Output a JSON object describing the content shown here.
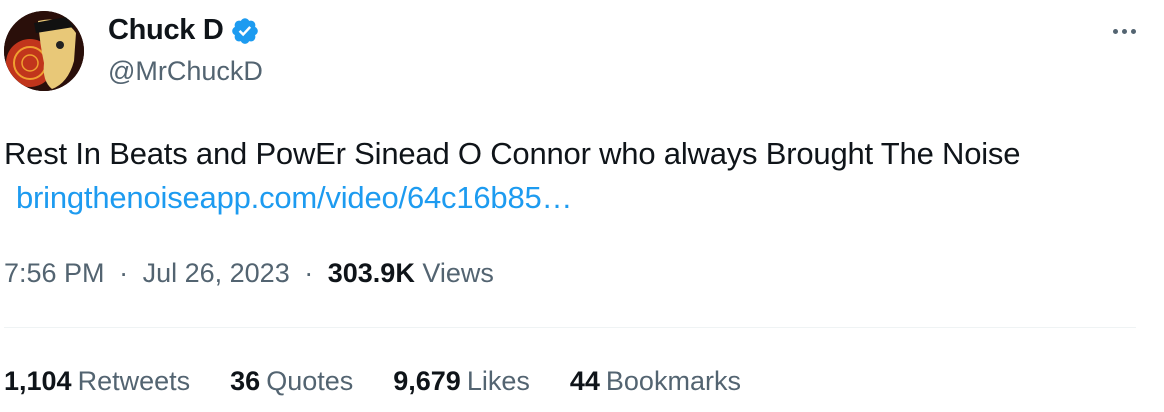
{
  "author": {
    "display_name": "Chuck D",
    "handle": "@MrChuckD",
    "verified": true,
    "avatar_icon": "profile-photo"
  },
  "menu": {
    "icon": "more-horizontal-icon"
  },
  "tweet": {
    "text": "Rest In Beats and PowEr Sinead O Connor who always Brought The Noise",
    "link": "bringthenoiseapp.com/video/64c16b85…",
    "link_color": "#1d9bf0"
  },
  "meta": {
    "time": "7:56 PM",
    "date": "Jul 26, 2023",
    "views_count": "303.9K",
    "views_label": "Views",
    "separator": "·"
  },
  "stats": [
    {
      "count": "1,104",
      "label": "Retweets"
    },
    {
      "count": "36",
      "label": "Quotes"
    },
    {
      "count": "9,679",
      "label": "Likes"
    },
    {
      "count": "44",
      "label": "Bookmarks"
    }
  ]
}
